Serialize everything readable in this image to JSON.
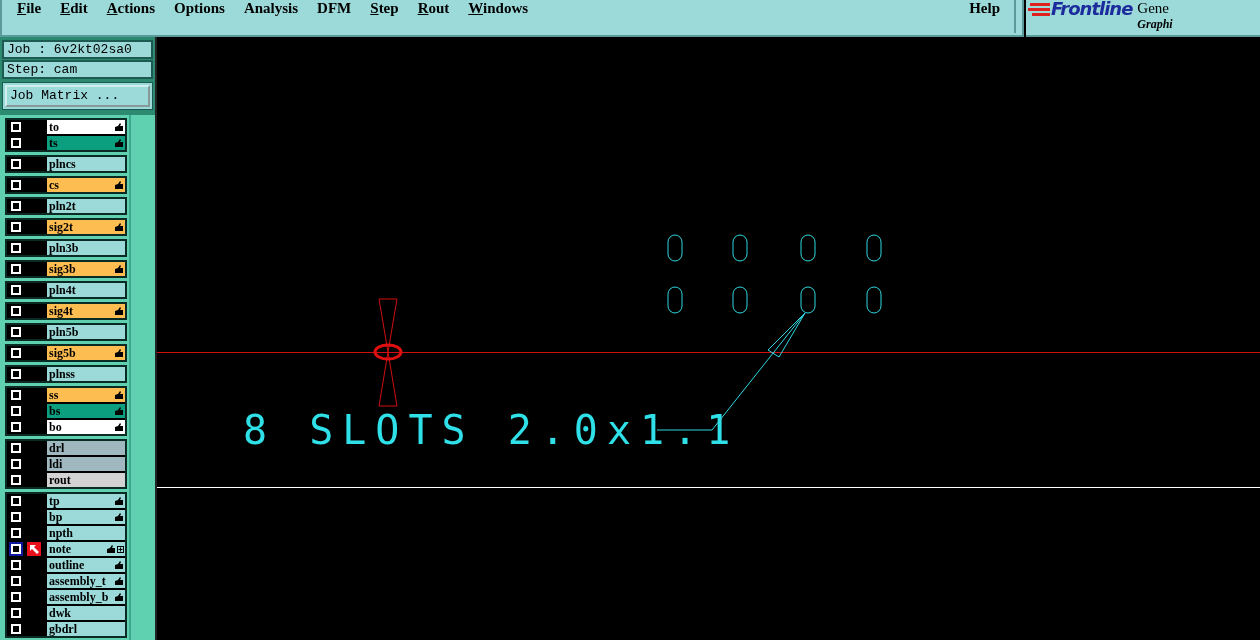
{
  "menu": [
    {
      "label": "File",
      "mnemonic": true
    },
    {
      "label": "Edit",
      "mnemonic": true
    },
    {
      "label": "Actions",
      "mnemonic": true
    },
    {
      "label": "Options",
      "mnemonic": false
    },
    {
      "label": "Analysis",
      "mnemonic": false
    },
    {
      "label": "DFM",
      "mnemonic": false
    },
    {
      "label": "Step",
      "mnemonic": true
    },
    {
      "label": "Rout",
      "mnemonic": true
    },
    {
      "label": "Windows",
      "mnemonic": true
    }
  ],
  "help": "Help",
  "logo": {
    "brand": "Frontline",
    "product": "Gene",
    "subtitle": "Graphi"
  },
  "job": "Job : 6v2kt02sa0",
  "step": "Step: cam",
  "matrix_button": "Job Matrix ...",
  "layer_groups": [
    [
      {
        "name": "to",
        "color": "#ffffff",
        "affected": true,
        "active": false,
        "checked": false,
        "attr": false
      },
      {
        "name": "ts",
        "color": "#0c9f7f",
        "affected": true,
        "active": false,
        "checked": false,
        "attr": false
      }
    ],
    [
      {
        "name": "plncs",
        "color": "#9cd9d9",
        "affected": false,
        "active": false,
        "checked": false,
        "attr": false
      }
    ],
    [
      {
        "name": "cs",
        "color": "#fdbd50",
        "affected": true,
        "active": false,
        "checked": false,
        "attr": false
      }
    ],
    [
      {
        "name": "pln2t",
        "color": "#9cd9d9",
        "affected": false,
        "active": false,
        "checked": false,
        "attr": false
      }
    ],
    [
      {
        "name": "sig2t",
        "color": "#fdbd50",
        "affected": true,
        "active": false,
        "checked": false,
        "attr": false
      }
    ],
    [
      {
        "name": "pln3b",
        "color": "#9cd9d9",
        "affected": false,
        "active": false,
        "checked": false,
        "attr": false
      }
    ],
    [
      {
        "name": "sig3b",
        "color": "#fdbd50",
        "affected": true,
        "active": false,
        "checked": false,
        "attr": false
      }
    ],
    [
      {
        "name": "pln4t",
        "color": "#9cd9d9",
        "affected": false,
        "active": false,
        "checked": false,
        "attr": false
      }
    ],
    [
      {
        "name": "sig4t",
        "color": "#fdbd50",
        "affected": true,
        "active": false,
        "checked": false,
        "attr": false
      }
    ],
    [
      {
        "name": "pln5b",
        "color": "#9cd9d9",
        "affected": false,
        "active": false,
        "checked": false,
        "attr": false
      }
    ],
    [
      {
        "name": "sig5b",
        "color": "#fdbd50",
        "affected": true,
        "active": false,
        "checked": false,
        "attr": false
      }
    ],
    [
      {
        "name": "plnss",
        "color": "#9cd9d9",
        "affected": false,
        "active": false,
        "checked": false,
        "attr": false
      }
    ],
    [
      {
        "name": "ss",
        "color": "#fdbd50",
        "affected": true,
        "active": false,
        "checked": false,
        "attr": false
      },
      {
        "name": "bs",
        "color": "#0c9f7f",
        "affected": true,
        "active": false,
        "checked": false,
        "attr": false
      },
      {
        "name": "bo",
        "color": "#ffffff",
        "affected": true,
        "active": false,
        "checked": false,
        "attr": false
      }
    ],
    [
      {
        "name": "drl",
        "color": "#9fb8bf",
        "affected": false,
        "active": false,
        "checked": false,
        "attr": false
      },
      {
        "name": "ldi",
        "color": "#9fb8bf",
        "affected": false,
        "active": false,
        "checked": false,
        "attr": false
      },
      {
        "name": "rout",
        "color": "#d3d3d3",
        "affected": false,
        "active": false,
        "checked": false,
        "attr": false
      }
    ],
    [
      {
        "name": "tp",
        "color": "#9cd9d9",
        "affected": true,
        "active": false,
        "checked": false,
        "attr": false
      },
      {
        "name": "bp",
        "color": "#9cd9d9",
        "affected": true,
        "active": false,
        "checked": false,
        "attr": false
      },
      {
        "name": "npth",
        "color": "#9cd9d9",
        "affected": false,
        "active": false,
        "checked": false,
        "attr": false
      },
      {
        "name": "note",
        "color": "#9cd9d9",
        "affected": true,
        "active": true,
        "checked": false,
        "attr": true
      },
      {
        "name": "outline",
        "color": "#9cd9d9",
        "affected": true,
        "active": false,
        "checked": false,
        "attr": false
      },
      {
        "name": "assembly_t",
        "color": "#9cd9d9",
        "affected": true,
        "active": false,
        "checked": false,
        "attr": false
      },
      {
        "name": "assembly_b",
        "color": "#9cd9d9",
        "affected": true,
        "active": false,
        "checked": false,
        "attr": false
      },
      {
        "name": "dwk",
        "color": "#9cd9d9",
        "affected": false,
        "active": false,
        "checked": false,
        "attr": false
      },
      {
        "name": "gbdrl",
        "color": "#9cd9d9",
        "affected": false,
        "active": false,
        "checked": false,
        "attr": false
      }
    ]
  ],
  "canvas": {
    "annotation": "8 SLOTS 2.0x1.1"
  }
}
